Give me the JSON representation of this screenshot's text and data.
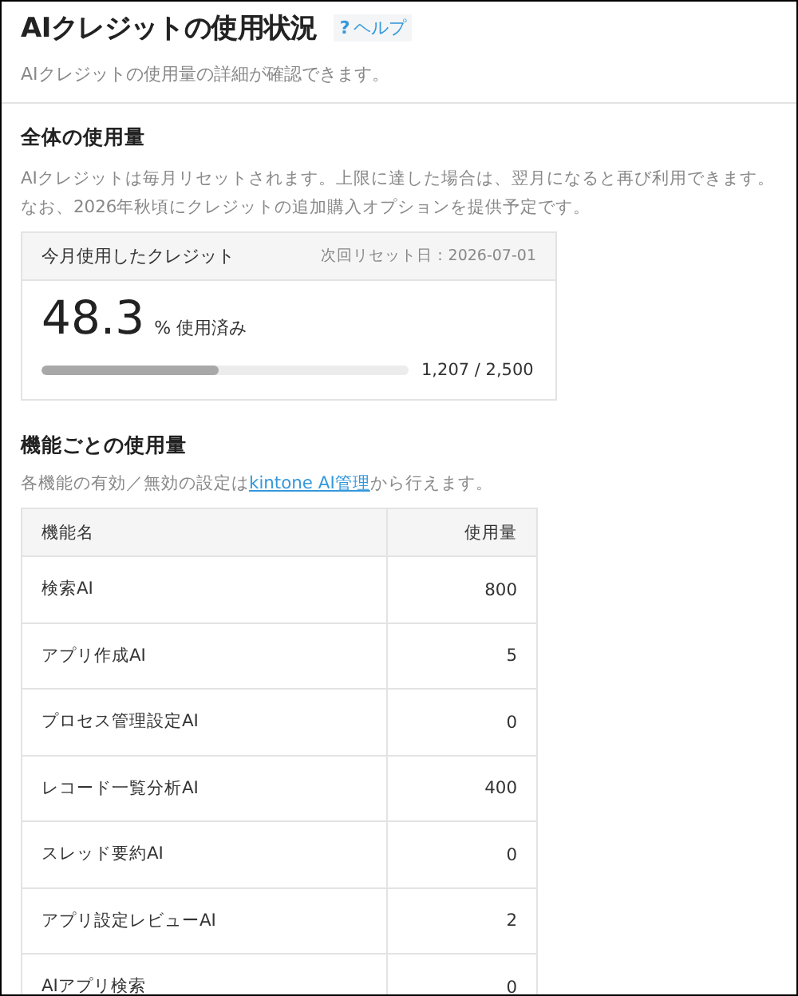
{
  "header": {
    "title": "AIクレジットの使用状況",
    "help_icon": "?",
    "help_link": "ヘルプ",
    "subtitle": "AIクレジットの使用量の詳細が確認できます。"
  },
  "overall": {
    "heading": "全体の使用量",
    "note_lines": [
      "AIクレジットは毎月リセットされます。上限に達した場合は、翌月になると再び利用できます。",
      "なお、2026年秋頃にクレジットの追加購入オプションを提供予定です。"
    ],
    "card": {
      "title": "今月使用したクレジット",
      "next_reset": "次回リセット日：2026-07-01",
      "percent": "48.3",
      "percent_unit": "% 使用済み",
      "level": 0.483,
      "reading": "1,207 / 2,500"
    }
  },
  "features": {
    "heading": "機能ごとの使用量",
    "description": {
      "before": "各機能の有効／無効の設定は",
      "link": "kintone AI管理",
      "after": "から行えます。"
    },
    "table": {
      "columns": [
        "機能名",
        "使用量"
      ],
      "rows": [
        {
          "name": "検索AI",
          "usage": "800"
        },
        {
          "name": "アプリ作成AI",
          "usage": "5"
        },
        {
          "name": "プロセス管理設定AI",
          "usage": "0"
        },
        {
          "name": "レコード一覧分析AI",
          "usage": "400"
        },
        {
          "name": "スレッド要約AI",
          "usage": "0"
        },
        {
          "name": "アプリ設定レビューAI",
          "usage": "2"
        },
        {
          "name": "AIアプリ検索",
          "usage": "0"
        }
      ]
    }
  }
}
